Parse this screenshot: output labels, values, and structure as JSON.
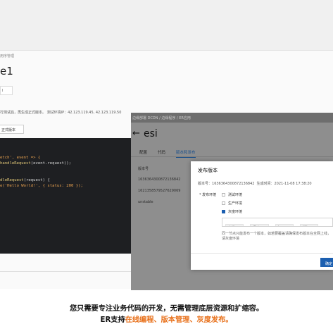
{
  "back_window": {
    "breadcrumb": "用序管理",
    "title": "e1",
    "tab": "l",
    "description": "行测试后，再生成正式版本。 测试环境IP：42.123.119.45, 42.123.119.50",
    "generate_button": "正式版本",
    "code_lines": [
      [],
      [
        {
          "t": "etch', event => {",
          "c": "str"
        }
      ],
      [
        {
          "t": "handleRequest",
          "c": "fn"
        },
        {
          "t": "(event.request));",
          "c": ""
        }
      ],
      [],
      [
        {
          "t": "",
          "c": ""
        }
      ],
      [
        {
          "t": "dleRequest",
          "c": "fn"
        },
        {
          "t": "(request) {",
          "c": ""
        }
      ],
      [
        {
          "t": "e('Hello World!', { status: 200 });",
          "c": "str"
        }
      ]
    ]
  },
  "front_window": {
    "breadcrumb": "边缘部署 DCDN  /  边缘程序  /  ER应用",
    "title": "esi",
    "tabs": [
      "配置",
      "代码",
      "版本和发布"
    ],
    "active_tab": 2,
    "version_label": "版本号",
    "versions": [
      "1636364300872136842",
      "1621358579527629069",
      "unstable"
    ]
  },
  "dialog": {
    "title": "发布版本",
    "version_prefix": "版本号：",
    "version_value": "1636364300872136842",
    "created_prefix": "生成时间：",
    "created_value": "2021-11-08 17:38:20",
    "env_label": "* 发布环境",
    "options": [
      {
        "label": "测试环境",
        "checked": false
      },
      {
        "label": "生产环境",
        "checked": false
      },
      {
        "label": "灰度环境",
        "checked": true
      }
    ],
    "chips": [
      "安徽",
      "重庆",
      "江西",
      "浙江"
    ],
    "note": "同一节点只能发布一个版本，如若要覆盖请确保发布版本在全网上线，请灰度环境",
    "ok_button": "确定"
  },
  "caption": {
    "line1": "您只需要专注业务代码的开发，无需管理底层资源和扩缩容。",
    "line2_prefix": "ER支持",
    "line2_highlight": "在线编程、版本管理、灰度发布。"
  },
  "colors": {
    "primary": "#1c5fb0",
    "highlight": "#e8701a",
    "code_bg": "#1e1f22"
  }
}
